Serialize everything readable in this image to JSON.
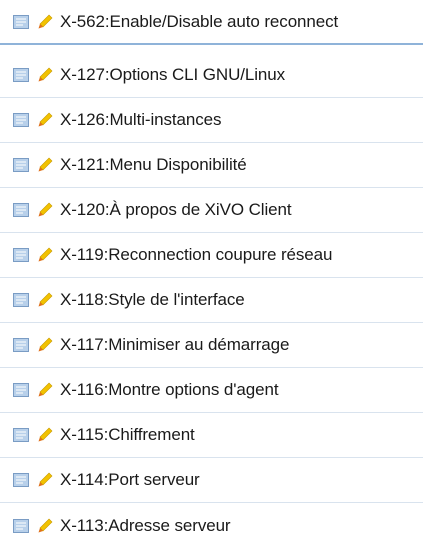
{
  "list": {
    "items": [
      {
        "label": "X-562:Enable/Disable auto reconnect",
        "doc_icon": "page-icon",
        "edit_icon": "pencil-icon"
      },
      {
        "label": "X-127:Options CLI GNU/Linux",
        "doc_icon": "page-icon",
        "edit_icon": "pencil-icon"
      },
      {
        "label": "X-126:Multi-instances",
        "doc_icon": "page-icon",
        "edit_icon": "pencil-icon"
      },
      {
        "label": "X-121:Menu Disponibilité",
        "doc_icon": "page-icon",
        "edit_icon": "pencil-icon"
      },
      {
        "label": "X-120:À propos de XiVO Client",
        "doc_icon": "page-icon",
        "edit_icon": "pencil-icon"
      },
      {
        "label": "X-119:Reconnection coupure réseau",
        "doc_icon": "page-icon",
        "edit_icon": "pencil-icon"
      },
      {
        "label": "X-118:Style de l'interface",
        "doc_icon": "page-icon",
        "edit_icon": "pencil-icon"
      },
      {
        "label": "X-117:Minimiser au démarrage",
        "doc_icon": "page-icon",
        "edit_icon": "pencil-icon"
      },
      {
        "label": "X-116:Montre options d'agent",
        "doc_icon": "page-icon",
        "edit_icon": "pencil-icon"
      },
      {
        "label": "X-115:Chiffrement",
        "doc_icon": "page-icon",
        "edit_icon": "pencil-icon"
      },
      {
        "label": "X-114:Port serveur",
        "doc_icon": "page-icon",
        "edit_icon": "pencil-icon"
      },
      {
        "label": "X-113:Adresse serveur",
        "doc_icon": "page-icon",
        "edit_icon": "pencil-icon"
      }
    ]
  },
  "colors": {
    "row_divider": "#d9e3ee",
    "highlight_divider": "#8fb3d9",
    "text": "#1a1a1a",
    "doc_icon_fill": "#b8d0ea",
    "doc_icon_stroke": "#7a9cc4",
    "pencil_body": "#f2c200",
    "pencil_tip": "#e0701a"
  }
}
